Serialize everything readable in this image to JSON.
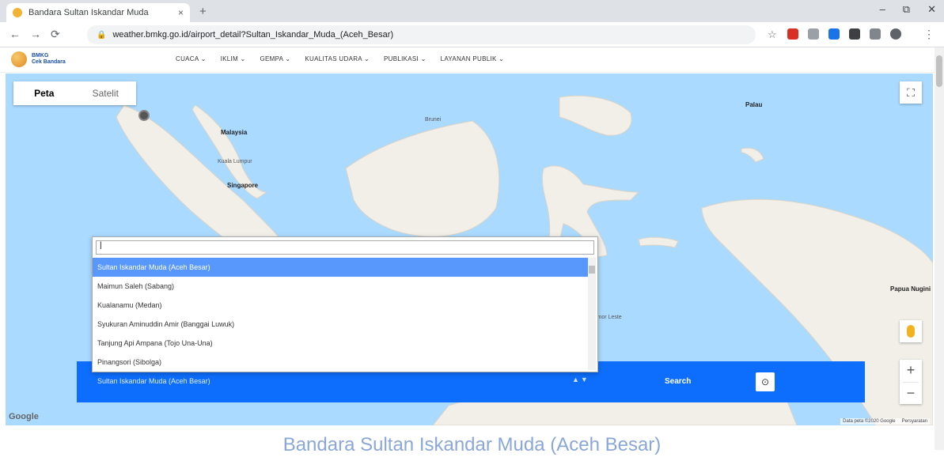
{
  "browser": {
    "tab_title": "Bandara Sultan Iskandar Muda",
    "tab_close": "×",
    "new_tab": "+",
    "window_controls": [
      "–",
      "⧉",
      "✕"
    ],
    "nav": {
      "back": "←",
      "forward": "→",
      "reload": "⟳"
    },
    "url": "weather.bmkg.go.id/airport_detail?Sultan_Iskandar_Muda_(Aceh_Besar)",
    "lock": "🔒",
    "star": "☆",
    "menu": "⋮"
  },
  "site": {
    "logo_text_line1": "BMKG",
    "logo_text_line2": "Cek Bandara",
    "menu": [
      "CUACA ⌄",
      "IKLIM ⌄",
      "GEMPA ⌄",
      "KUALITAS UDARA ⌄",
      "PUBLIKASI ⌄",
      "LAYANAN PUBLIK ⌄"
    ]
  },
  "map": {
    "type_map": "Peta",
    "type_satellite": "Satelit",
    "fullscreen": "⛶",
    "zoom_in": "+",
    "zoom_out": "−",
    "google": "Google",
    "attribution": [
      "Data peta ©2020 Google",
      "Persyaratan"
    ],
    "labels": [
      {
        "text": "Malaysia",
        "big": true
      },
      {
        "text": "Singapore",
        "big": true
      },
      {
        "text": "Brunei",
        "big": false
      },
      {
        "text": "Palau",
        "big": true
      },
      {
        "text": "Papua Nugini",
        "big": true
      },
      {
        "text": "Timor Leste",
        "big": false
      },
      {
        "text": "Kuala Lumpur",
        "big": false
      }
    ]
  },
  "search": {
    "input_value": "|",
    "options": [
      "Sultan Iskandar Muda (Aceh Besar)",
      "Maimun Saleh (Sabang)",
      "Kualanamu (Medan)",
      "Syukuran Aminuddin Amir (Banggai Luwuk)",
      "Tanjung Api Ampana (Tojo Una-Una)",
      "Pinangsori (Sibolga)"
    ],
    "selected_value": "Sultan Iskandar Muda (Aceh Besar)",
    "arrows": "▲▼",
    "search_label": "Search",
    "gps_icon": "⊙"
  },
  "page_title": "Bandara Sultan Iskandar Muda (Aceh Besar)",
  "colors": {
    "accent": "#0d6efd",
    "dropdown_highlight": "#5897fb",
    "water": "#aadaff",
    "land": "#f2efe9"
  }
}
